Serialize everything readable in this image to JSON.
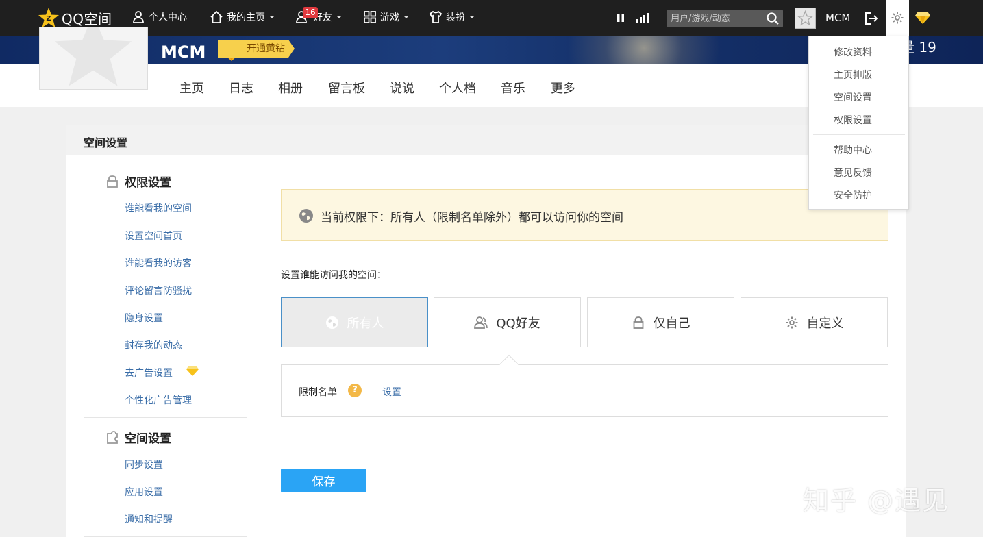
{
  "topbar": {
    "logo_text": "QQ空间",
    "nav": [
      {
        "label": "个人中心",
        "icon": "person-icon"
      },
      {
        "label": "我的主页",
        "icon": "home-icon"
      },
      {
        "label": "好友",
        "icon": "friends-icon",
        "badge": "16"
      },
      {
        "label": "游戏",
        "icon": "grid-icon"
      },
      {
        "label": "装扮",
        "icon": "shirt-icon"
      }
    ],
    "search_placeholder": "用户/游戏/动态",
    "username": "MCM"
  },
  "banner": {
    "name": "MCM",
    "vip_label": "开通黄钻",
    "visit_count": "量 19"
  },
  "profile_tabs": [
    "主页",
    "日志",
    "相册",
    "留言板",
    "说说",
    "个人档",
    "音乐",
    "更多"
  ],
  "panel": {
    "title": "空间设置",
    "groups": [
      {
        "title": "权限设置",
        "icon": "lock-icon",
        "links": [
          "谁能看我的空间",
          "设置空间首页",
          "谁能看我的访客",
          "评论留言防骚扰",
          "隐身设置",
          "封存我的动态",
          "去广告设置",
          "个性化广告管理"
        ]
      },
      {
        "title": "空间设置",
        "icon": "puzzle-icon",
        "links": [
          "同步设置",
          "应用设置",
          "通知和提醒"
        ]
      }
    ],
    "notice": "当前权限下：所有人（限制名单除外）都可以访问你的空间",
    "setting_label": "设置谁能访问我的空间：",
    "options": [
      {
        "label": "所有人",
        "icon": "globe-icon",
        "active": true
      },
      {
        "label": "QQ好友",
        "icon": "friends-icon",
        "active": false
      },
      {
        "label": "仅自己",
        "icon": "lock-icon",
        "active": false
      },
      {
        "label": "自定义",
        "icon": "gear-icon",
        "active": false
      }
    ],
    "limit_label": "限制名单",
    "limit_help": "?",
    "limit_action": "设置",
    "save_label": "保存"
  },
  "dropdown": {
    "items": [
      "修改资料",
      "主页排版",
      "空间设置",
      "权限设置"
    ],
    "items2": [
      "帮助中心",
      "意见反馈",
      "安全防护"
    ]
  },
  "watermark": "知乎 @遇见"
}
